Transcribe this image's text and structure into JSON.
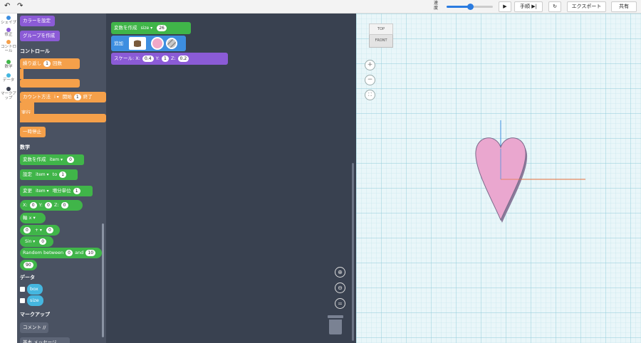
{
  "toolbar": {
    "undo_icon": "undo-arrow-icon",
    "redo_icon": "redo-arrow-icon",
    "speed_label": "速度",
    "speed_value": 0.5,
    "play_icon": "play-icon",
    "step_label": "手順",
    "step_icon": "step-icon",
    "reset_icon": "reset-icon",
    "export_label": "エクスポート",
    "share_label": "共有"
  },
  "categories": [
    {
      "label": "シェイプ",
      "color": "#3d8ee0"
    },
    {
      "label": "修正",
      "color": "#8b5bd6"
    },
    {
      "label": "コントロール",
      "color": "#f5a04a"
    },
    {
      "label": "数学",
      "color": "#40b549"
    },
    {
      "label": "データ",
      "color": "#45b6df"
    },
    {
      "label": "マークアップ",
      "color": "#3b4151"
    }
  ],
  "flyout": {
    "color_block": "カラーを設定",
    "group_block": "グループを作成",
    "control_header": "コントロール",
    "repeat": {
      "label": "繰り返し",
      "count": "1",
      "suffix": "回数"
    },
    "count_with": {
      "label": "カウント方法",
      "var": "i",
      "start_label": "開始",
      "start": "1",
      "end_label": "終了"
    },
    "do_label": "実行",
    "pause": "一時停止",
    "math_header": "数学",
    "create_var": {
      "label": "変数を作成",
      "var": "item",
      "value": "0"
    },
    "set_var": {
      "label": "設定",
      "var": "item",
      "to": "to",
      "value": "1"
    },
    "change_var": {
      "label": "変更",
      "var": "item",
      "by": "増分単位",
      "value": "1"
    },
    "xyz": {
      "x_label": "X:",
      "x": "0",
      "y_label": "Y:",
      "y": "0",
      "z_label": "Z:",
      "z": "0"
    },
    "axis": "軸 x",
    "arith": {
      "a": "0",
      "op": "+",
      "b": "0"
    },
    "sin": {
      "fn": "Sin",
      "value": "0"
    },
    "random": {
      "label": "Random between",
      "from": "0",
      "and": "and",
      "to": "10"
    },
    "number": "90",
    "data_header": "データ",
    "data_vars": [
      "box",
      "size"
    ],
    "markup_header": "マークアップ",
    "comment": "コメント //",
    "partial": "基本 メッセージ"
  },
  "workspace": {
    "create_var": {
      "label": "変数を作成",
      "var": "size",
      "value": "26"
    },
    "add": {
      "label": "追加",
      "shape_icon": "heart-shape-icon",
      "color": "#f0a8c8",
      "pattern_icon": "hollow-pattern-icon"
    },
    "scale": {
      "label": "スケール:",
      "x_label": "X:",
      "x": "0.4",
      "y_label": "Y:",
      "y": "1",
      "z_label": "Z:",
      "z": "0.2"
    },
    "zoom_in_icon": "zoom-in-icon",
    "zoom_out_icon": "zoom-out-icon",
    "zoom_reset_icon": "zoom-reset-icon",
    "trash_icon": "trash-icon"
  },
  "viewport": {
    "cube_top": "TOP",
    "cube_front": "FRONT",
    "zoom_in_icon": "plus-icon",
    "zoom_out_icon": "minus-icon",
    "fit_icon": "fit-view-icon",
    "heart_color": "#eaa7cf",
    "heart_edge": "#8a7a9a"
  }
}
